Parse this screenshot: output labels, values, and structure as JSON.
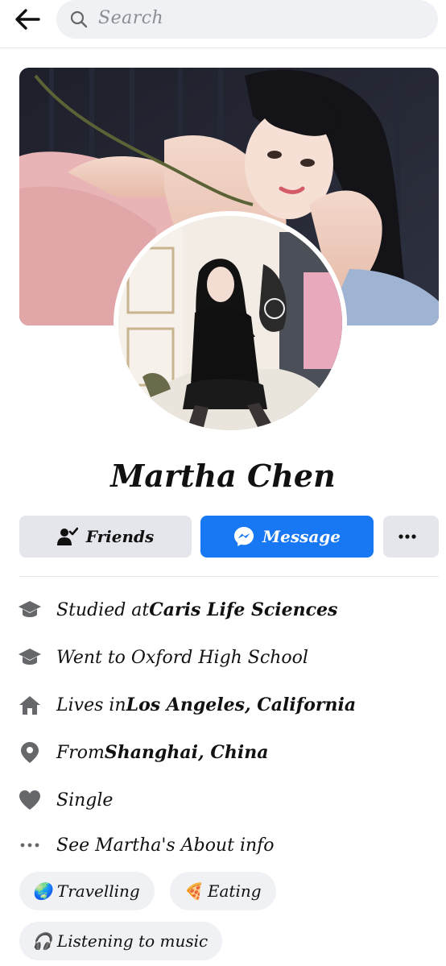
{
  "header": {
    "search_placeholder": "Search"
  },
  "profile": {
    "name": "Martha Chen"
  },
  "actions": {
    "friends_label": "Friends",
    "message_label": "Message"
  },
  "about": [
    {
      "prefix": "Studied at ",
      "bold": "Caris Life Sciences",
      "icon": "graduation-cap-icon"
    },
    {
      "prefix": "Went to Oxford High School",
      "bold": "",
      "icon": "graduation-cap-icon"
    },
    {
      "prefix": "Lives in ",
      "bold": "Los Angeles, California",
      "icon": "home-icon"
    },
    {
      "prefix": "From ",
      "bold": "Shanghai, China",
      "icon": "location-pin-icon"
    },
    {
      "prefix": "Single",
      "bold": "",
      "icon": "heart-icon"
    },
    {
      "prefix": "See Martha's About info",
      "bold": "",
      "icon": "more-dots-icon"
    }
  ],
  "hobbies": [
    {
      "emoji": "🌏",
      "label": "Travelling",
      "icon": "globe-icon"
    },
    {
      "emoji": "🍕",
      "label": "Eating",
      "icon": "pizza-icon"
    },
    {
      "emoji": "🎧",
      "label": "Listening to music",
      "icon": "headphones-icon"
    }
  ],
  "colors": {
    "accent": "#1877f2",
    "button_gray": "#e4e6eb",
    "icon_gray": "#65676b"
  }
}
